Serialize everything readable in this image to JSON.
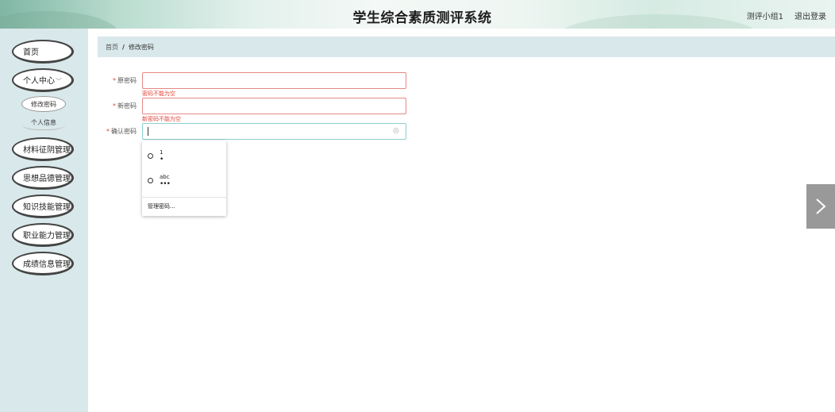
{
  "header": {
    "title": "学生综合素质测评系统",
    "user_label": "测评小组1",
    "logout_label": "退出登录"
  },
  "sidebar": {
    "items": [
      {
        "label": "首页"
      },
      {
        "label": "个人中心"
      },
      {
        "label": "材料征阴管理"
      },
      {
        "label": "思想品德管理"
      },
      {
        "label": "知识技能管理"
      },
      {
        "label": "职业能力管理"
      },
      {
        "label": "成绩信息管理"
      }
    ],
    "sub_items": [
      {
        "label": "修改密码"
      },
      {
        "label": "个人信息"
      }
    ]
  },
  "breadcrumb": {
    "home": "首页",
    "separator": "/",
    "current": "修改密码"
  },
  "form": {
    "old_password": {
      "label": "原密码",
      "value": "",
      "error": "密码不能为空"
    },
    "new_password": {
      "label": "新密码",
      "value": "",
      "error": "新密码不能为空"
    },
    "confirm_password": {
      "label": "确认密码",
      "value": ""
    }
  },
  "autocomplete": {
    "entries": [
      {
        "username": "1",
        "masked": "•"
      },
      {
        "username": "abc",
        "masked": "•••"
      }
    ],
    "manage_label": "管理密码..."
  },
  "colors": {
    "sidebar_bg": "#d9e8ea",
    "error": "#e4463a",
    "focus_border": "#8ccfd0"
  }
}
